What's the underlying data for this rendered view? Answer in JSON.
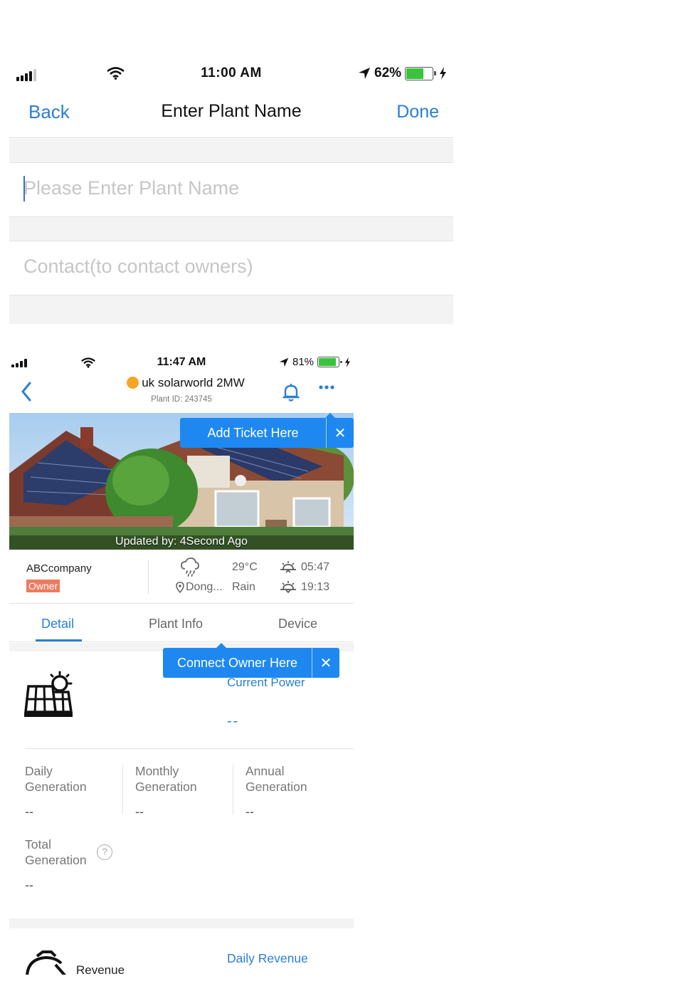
{
  "screen1": {
    "status": {
      "time": "11:00 AM",
      "battery": "62%",
      "battery_level": 0.62
    },
    "nav": {
      "back": "Back",
      "title": "Enter Plant Name",
      "done": "Done"
    },
    "fields": {
      "plant_name_placeholder": "Please Enter Plant Name",
      "contact_placeholder": "Contact(to contact owners)"
    }
  },
  "screen2": {
    "status": {
      "time": "11:47 AM",
      "battery": "81%",
      "battery_level": 0.81
    },
    "header": {
      "plant_name": "uk solarworld 2MW",
      "plant_id": "Plant ID: 243745"
    },
    "photo": {
      "updated": "Updated by: 4Second Ago"
    },
    "tips": {
      "add_ticket": "Add Ticket Here",
      "connect_owner": "Connect Owner Here"
    },
    "info": {
      "company": "ABCcompany",
      "role_badge": "Owner",
      "temperature": "29°C",
      "location": "Dong...",
      "weather": "Rain",
      "sunrise": "05:47",
      "sunset": "19:13"
    },
    "tabs": [
      "Detail",
      "Plant Info",
      "Device"
    ],
    "current_power": {
      "label": "Current Power",
      "value": "--"
    },
    "generation": [
      {
        "label_line1": "Daily",
        "label_line2": "Generation",
        "value": "--"
      },
      {
        "label_line1": "Monthly",
        "label_line2": "Generation",
        "value": "--"
      },
      {
        "label_line1": "Annual",
        "label_line2": "Generation",
        "value": "--"
      }
    ],
    "total_generation": {
      "label_line1": "Total",
      "label_line2": "Generation",
      "value": "--",
      "help": "?"
    },
    "revenue": {
      "label": "Revenue",
      "daily": "Daily Revenue"
    }
  },
  "colors": {
    "accent": "#2a7fd4",
    "tooltip": "#1e88f0",
    "badge": "#f07a5e",
    "battery": "#39c43c",
    "separator": "#f3f3f3"
  },
  "icons": [
    "signal-icon",
    "wifi-icon",
    "location-arrow-icon",
    "battery-icon",
    "charging-icon",
    "chevron-left-icon",
    "sun-dot-icon",
    "bell-icon",
    "more-icon",
    "close-icon",
    "rain-cloud-icon",
    "location-pin-icon",
    "sunrise-icon",
    "sunset-icon",
    "solar-panel-icon",
    "help-icon",
    "revenue-gauge-icon"
  ]
}
